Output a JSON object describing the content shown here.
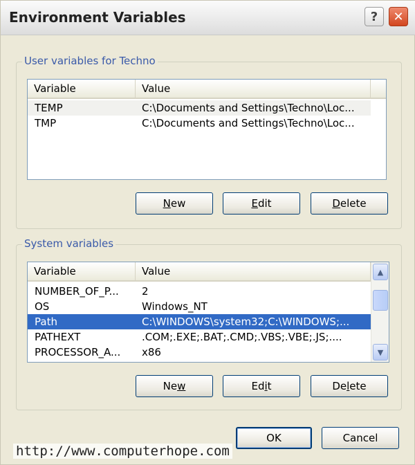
{
  "window": {
    "title": "Environment Variables"
  },
  "titlebar_buttons": {
    "help_glyph": "?",
    "close_glyph": "✕"
  },
  "user_group": {
    "label": "User variables for Techno",
    "columns": [
      "Variable",
      "Value"
    ],
    "rows": [
      {
        "variable": "TEMP",
        "value": "C:\\Documents and Settings\\Techno\\Loc..."
      },
      {
        "variable": "TMP",
        "value": "C:\\Documents and Settings\\Techno\\Loc..."
      }
    ],
    "buttons": {
      "new": {
        "access": "N",
        "rest": "ew"
      },
      "edit": {
        "access": "E",
        "rest": "dit"
      },
      "delete": {
        "access": "D",
        "rest": "elete"
      }
    }
  },
  "system_group": {
    "label": "System variables",
    "columns": [
      "Variable",
      "Value"
    ],
    "rows": [
      {
        "variable": "NUMBER_OF_P...",
        "value": "2"
      },
      {
        "variable": "OS",
        "value": "Windows_NT"
      },
      {
        "variable": "Path",
        "value": "C:\\WINDOWS\\system32;C:\\WINDOWS;..."
      },
      {
        "variable": "PATHEXT",
        "value": ".COM;.EXE;.BAT;.CMD;.VBS;.VBE;.JS;...."
      },
      {
        "variable": "PROCESSOR_A...",
        "value": "x86"
      }
    ],
    "selected_index": 2,
    "buttons": {
      "new": {
        "access": "w",
        "pre": "Ne"
      },
      "edit": {
        "access": "i",
        "pre": "Ed",
        "post": "t"
      },
      "delete": {
        "access": "l",
        "pre": "De",
        "post": "ete"
      }
    }
  },
  "dialog_buttons": {
    "ok": "OK",
    "cancel": "Cancel"
  },
  "watermark": "http://www.computerhope.com",
  "colors": {
    "selection": "#316ac5",
    "group_label": "#3a5aa9",
    "close_button": "#d2461f"
  }
}
